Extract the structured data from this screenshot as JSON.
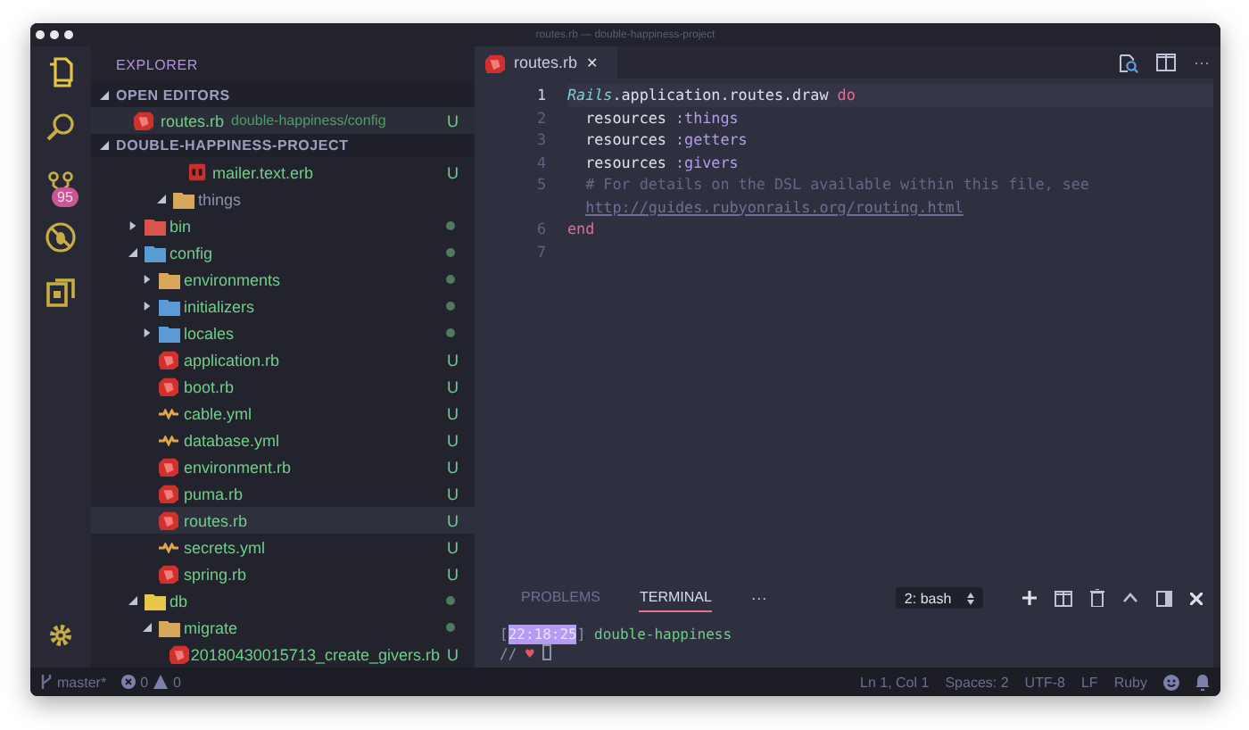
{
  "window": {
    "title": "routes.rb — double-happiness-project"
  },
  "activity_bar": {
    "items": [
      {
        "kind": "files",
        "selected": true
      },
      {
        "kind": "search",
        "selected": false
      },
      {
        "kind": "source-control",
        "selected": false,
        "badge": "95"
      },
      {
        "kind": "debug",
        "selected": false
      },
      {
        "kind": "extensions",
        "selected": false
      }
    ],
    "settings": {
      "kind": "gear"
    }
  },
  "sidebar": {
    "title": "EXPLORER",
    "open_editors": {
      "label": "OPEN EDITORS",
      "expanded": true,
      "items": [
        {
          "name": "routes.rb",
          "kind": "ruby",
          "path": "double-happiness/config",
          "status": "U"
        }
      ]
    },
    "project": {
      "label": "DOUBLE-HAPPINESS-PROJECT",
      "expanded": true
    },
    "tree": [
      {
        "children": [
          {
            "children": [
              {
                "children": [
                  {
                    "name": "mailer.text.erb",
                    "kind": "erb",
                    "untracked": true,
                    "status": "U",
                    "selected": false
                  }
                ]
              },
              {
                "name": "things",
                "kind": "folder",
                "expanded": true,
                "untracked": false,
                "selected": false
              }
            ]
          }
        ]
      },
      {
        "name": "bin",
        "kind": "folder-red",
        "expanded": false,
        "untracked": true,
        "modified": true,
        "selected": false
      },
      {
        "name": "config",
        "kind": "folder-blue",
        "expanded": true,
        "untracked": true,
        "modified": true,
        "selected": false,
        "children": [
          {
            "name": "environments",
            "kind": "folder",
            "expanded": false,
            "untracked": true,
            "modified": true,
            "selected": false
          },
          {
            "name": "initializers",
            "kind": "folder-blue",
            "expanded": false,
            "untracked": true,
            "modified": true,
            "selected": false
          },
          {
            "name": "locales",
            "kind": "folder-blue",
            "expanded": false,
            "untracked": true,
            "modified": true,
            "selected": false
          },
          {
            "name": "application.rb",
            "kind": "ruby",
            "untracked": true,
            "status": "U",
            "selected": false
          },
          {
            "name": "boot.rb",
            "kind": "ruby",
            "untracked": true,
            "status": "U",
            "selected": false
          },
          {
            "name": "cable.yml",
            "kind": "yaml",
            "untracked": true,
            "status": "U",
            "selected": false
          },
          {
            "name": "database.yml",
            "kind": "yaml",
            "untracked": true,
            "status": "U",
            "selected": false
          },
          {
            "name": "environment.rb",
            "kind": "ruby",
            "untracked": true,
            "status": "U",
            "selected": false
          },
          {
            "name": "puma.rb",
            "kind": "ruby",
            "untracked": true,
            "status": "U",
            "selected": false
          },
          {
            "name": "routes.rb",
            "kind": "ruby",
            "untracked": true,
            "status": "U",
            "selected": true
          },
          {
            "name": "secrets.yml",
            "kind": "yaml",
            "untracked": true,
            "status": "U",
            "selected": false
          },
          {
            "name": "spring.rb",
            "kind": "ruby",
            "untracked": true,
            "status": "U",
            "selected": false
          }
        ]
      },
      {
        "name": "db",
        "kind": "folder-yellow",
        "expanded": true,
        "untracked": true,
        "modified": true,
        "selected": false,
        "children": [
          {
            "name": "migrate",
            "kind": "folder",
            "expanded": true,
            "untracked": true,
            "modified": true,
            "selected": false,
            "children": [
              {
                "name": "20180430015713_create_givers.rb",
                "kind": "ruby",
                "untracked": true,
                "status": "U",
                "selected": false
              }
            ]
          }
        ]
      }
    ]
  },
  "editor": {
    "tabs": [
      {
        "label": "routes.rb",
        "kind": "ruby",
        "selected": true,
        "close": "✕"
      }
    ],
    "actions": {
      "more": "···"
    },
    "lines": [
      {
        "number": "1",
        "current": true,
        "rows": [
          [
            {
              "kind": "const",
              "text": "Rails"
            },
            {
              "kind": "plain",
              "text": ".application.routes.draw "
            },
            {
              "kind": "keyword",
              "text": "do"
            }
          ]
        ]
      },
      {
        "number": "2",
        "current": false,
        "rows": [
          [
            {
              "kind": "plain",
              "text": "  resources "
            },
            {
              "kind": "symbol",
              "text": ":things"
            }
          ]
        ]
      },
      {
        "number": "3",
        "current": false,
        "rows": [
          [
            {
              "kind": "plain",
              "text": "  resources "
            },
            {
              "kind": "symbol",
              "text": ":getters"
            }
          ]
        ]
      },
      {
        "number": "4",
        "current": false,
        "rows": [
          [
            {
              "kind": "plain",
              "text": "  resources "
            },
            {
              "kind": "symbol",
              "text": ":givers"
            }
          ]
        ]
      },
      {
        "number": "5",
        "current": false,
        "rows": [
          [
            {
              "kind": "comment",
              "text": "  # For details on the DSL available within this file, see"
            }
          ],
          [
            {
              "kind": "plain",
              "text": "  "
            },
            {
              "kind": "link",
              "text": "http://guides.rubyonrails.org/routing.html"
            }
          ]
        ]
      },
      {
        "number": "6",
        "current": false,
        "rows": [
          [
            {
              "kind": "keyword",
              "text": "end"
            }
          ]
        ]
      },
      {
        "number": "7",
        "current": false,
        "rows": [
          []
        ]
      }
    ]
  },
  "panel": {
    "tabs": [
      {
        "label": "PROBLEMS",
        "selected": false
      },
      {
        "label": "TERMINAL",
        "selected": true
      }
    ],
    "more": "···",
    "terminal_select": "2: bash",
    "terminal": [
      [
        {
          "kind": "bracket",
          "text": "["
        },
        {
          "kind": "time",
          "text": "22:18:25"
        },
        {
          "kind": "bracket",
          "text": "] "
        },
        {
          "kind": "dir",
          "text": "double-happiness"
        }
      ],
      [
        {
          "kind": "bracket",
          "text": "// "
        },
        {
          "kind": "heart",
          "text": "♥"
        },
        {
          "kind": "cursor"
        }
      ]
    ]
  },
  "status_bar": {
    "branch": "master*",
    "errors": "0",
    "warnings": "0",
    "position": "Ln 1, Col 1",
    "indent": "Spaces: 2",
    "encoding": "UTF-8",
    "eol": "LF",
    "language": "Ruby"
  }
}
